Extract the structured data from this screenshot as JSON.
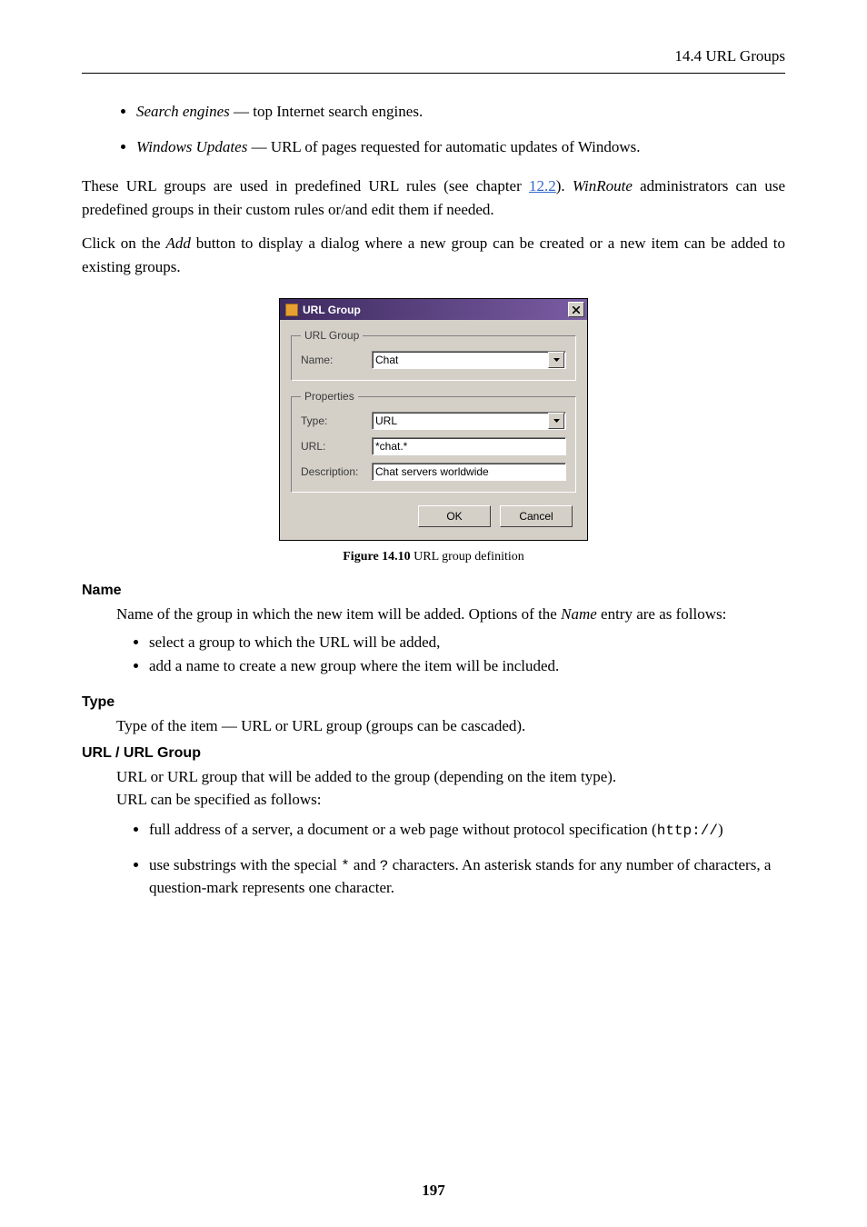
{
  "header": {
    "section": "14.4 URL Groups"
  },
  "intro_list": [
    {
      "term": "Search engines",
      "desc": " — top Internet search engines."
    },
    {
      "term": "Windows Updates",
      "desc": " — URL of pages requested for automatic updates of Windows."
    }
  ],
  "para1_a": "These URL groups are used in predefined URL rules (see chapter ",
  "para1_link": "12.2",
  "para1_b": "). ",
  "para1_it": "WinRoute",
  "para1_c": " administrators can use predefined groups in their custom rules or/and edit them if needed.",
  "para2_a": "Click on the ",
  "para2_it": "Add",
  "para2_b": " button to display a dialog where a new group can be created or a new item can be added to existing groups.",
  "dialog": {
    "title": "URL Group",
    "group1_legend": "URL Group",
    "name_label": "Name:",
    "name_value": "Chat",
    "group2_legend": "Properties",
    "type_label": "Type:",
    "type_value": "URL",
    "url_label": "URL:",
    "url_value": "*chat.*",
    "desc_label": "Description:",
    "desc_value": "Chat servers worldwide",
    "ok": "OK",
    "cancel": "Cancel"
  },
  "figure": {
    "bold": "Figure 14.10",
    "rest": "   URL group definition"
  },
  "defs": {
    "name_h": "Name",
    "name_p_a": "Name of the group in which the new item will be added. Options of the ",
    "name_p_it": "Name",
    "name_p_b": " entry are as follows:",
    "name_li1": "select a group to which the URL will be added,",
    "name_li2": "add a name to create a new group where the item will be included.",
    "type_h": "Type",
    "type_p": "Type of the item — URL or URL group (groups can be cascaded).",
    "urlg_h": "URL / URL Group",
    "urlg_p1": "URL or URL group that will be added to the group (depending on the item type).",
    "urlg_p2": "URL can be specified as follows:",
    "urlg_li1_a": "full address of a server, a document or a web page without protocol specification (",
    "urlg_li1_code": "http://",
    "urlg_li1_b": ")",
    "urlg_li2_a": "use substrings with the special ",
    "urlg_li2_c1": "*",
    "urlg_li2_mid": " and ",
    "urlg_li2_c2": "?",
    "urlg_li2_b": "  characters.  An asterisk stands for any number of characters, a question-mark represents one character."
  },
  "page_number": "197"
}
